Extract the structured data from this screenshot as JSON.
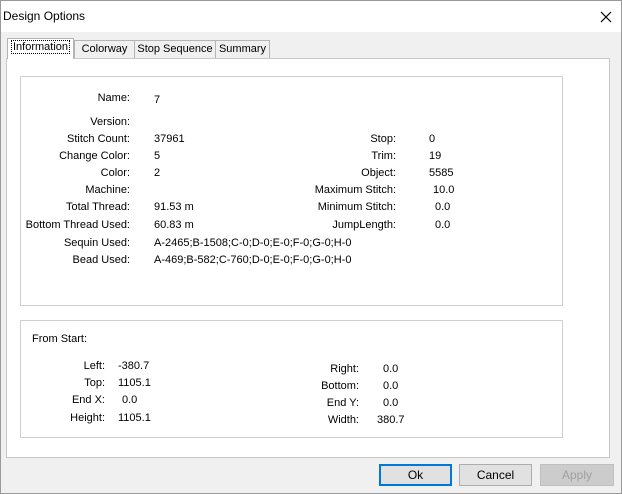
{
  "window": {
    "title": "Design Options",
    "close_icon": "close-icon"
  },
  "tabs": [
    {
      "label": "Information",
      "active": true
    },
    {
      "label": "Colorway",
      "active": false
    },
    {
      "label": "Stop Sequence",
      "active": false
    },
    {
      "label": "Summary",
      "active": false
    }
  ],
  "info": {
    "name_label": "Name:",
    "name_value": "7",
    "version_label": "Version:",
    "version_value": "",
    "stitch_count_label": "Stitch Count:",
    "stitch_count_value": "37961",
    "change_color_label": "Change Color:",
    "change_color_value": "5",
    "color_label": "Color:",
    "color_value": "2",
    "machine_label": "Machine:",
    "machine_value": "",
    "total_thread_label": "Total Thread:",
    "total_thread_value": "91.53 m",
    "bottom_thread_label": "Bottom Thread Used:",
    "bottom_thread_value": "60.83 m",
    "sequin_label": "Sequin Used:",
    "sequin_value": "A-2465;B-1508;C-0;D-0;E-0;F-0;G-0;H-0",
    "bead_label": "Bead Used:",
    "bead_value": "A-469;B-582;C-760;D-0;E-0;F-0;G-0;H-0",
    "stop_label": "Stop:",
    "stop_value": "0",
    "trim_label": "Trim:",
    "trim_value": "19",
    "object_label": "Object:",
    "object_value": "5585",
    "max_stitch_label": "Maximum Stitch:",
    "max_stitch_value": "10.0",
    "min_stitch_label": "Minimum Stitch:",
    "min_stitch_value": "0.0",
    "jump_length_label": "JumpLength:",
    "jump_length_value": "0.0"
  },
  "from_start": {
    "title": "From Start:",
    "left_label": "Left:",
    "left_value": "-380.7",
    "top_label": "Top:",
    "top_value": "1105.1",
    "endx_label": "End X:",
    "endx_value": "0.0",
    "height_label": "Height:",
    "height_value": "1105.1",
    "right_label": "Right:",
    "right_value": "0.0",
    "bottom_label": "Bottom:",
    "bottom_value": "0.0",
    "endy_label": "End Y:",
    "endy_value": "0.0",
    "width_label": "Width:",
    "width_value": "380.7"
  },
  "buttons": {
    "ok": "Ok",
    "cancel": "Cancel",
    "apply": "Apply"
  },
  "colors": {
    "accent": "#0078d7",
    "background": "#f0f0f0"
  }
}
